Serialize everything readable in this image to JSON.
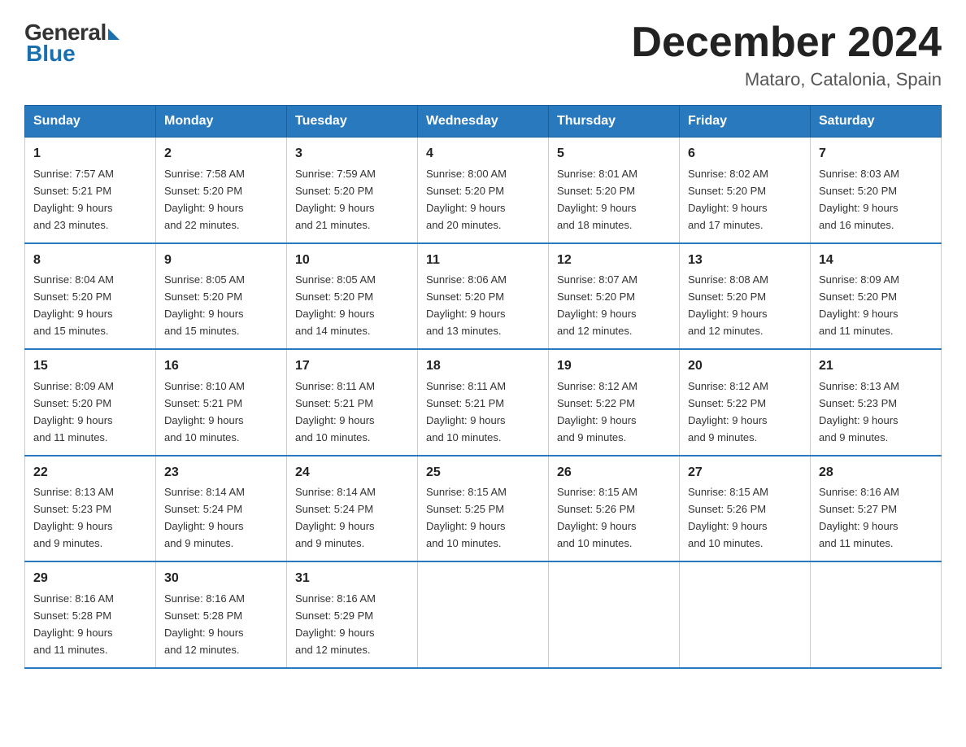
{
  "logo": {
    "general": "General",
    "blue": "Blue"
  },
  "title": "December 2024",
  "location": "Mataro, Catalonia, Spain",
  "days_of_week": [
    "Sunday",
    "Monday",
    "Tuesday",
    "Wednesday",
    "Thursday",
    "Friday",
    "Saturday"
  ],
  "weeks": [
    [
      {
        "day": "1",
        "sunrise": "7:57 AM",
        "sunset": "5:21 PM",
        "daylight": "9 hours and 23 minutes."
      },
      {
        "day": "2",
        "sunrise": "7:58 AM",
        "sunset": "5:20 PM",
        "daylight": "9 hours and 22 minutes."
      },
      {
        "day": "3",
        "sunrise": "7:59 AM",
        "sunset": "5:20 PM",
        "daylight": "9 hours and 21 minutes."
      },
      {
        "day": "4",
        "sunrise": "8:00 AM",
        "sunset": "5:20 PM",
        "daylight": "9 hours and 20 minutes."
      },
      {
        "day": "5",
        "sunrise": "8:01 AM",
        "sunset": "5:20 PM",
        "daylight": "9 hours and 18 minutes."
      },
      {
        "day": "6",
        "sunrise": "8:02 AM",
        "sunset": "5:20 PM",
        "daylight": "9 hours and 17 minutes."
      },
      {
        "day": "7",
        "sunrise": "8:03 AM",
        "sunset": "5:20 PM",
        "daylight": "9 hours and 16 minutes."
      }
    ],
    [
      {
        "day": "8",
        "sunrise": "8:04 AM",
        "sunset": "5:20 PM",
        "daylight": "9 hours and 15 minutes."
      },
      {
        "day": "9",
        "sunrise": "8:05 AM",
        "sunset": "5:20 PM",
        "daylight": "9 hours and 15 minutes."
      },
      {
        "day": "10",
        "sunrise": "8:05 AM",
        "sunset": "5:20 PM",
        "daylight": "9 hours and 14 minutes."
      },
      {
        "day": "11",
        "sunrise": "8:06 AM",
        "sunset": "5:20 PM",
        "daylight": "9 hours and 13 minutes."
      },
      {
        "day": "12",
        "sunrise": "8:07 AM",
        "sunset": "5:20 PM",
        "daylight": "9 hours and 12 minutes."
      },
      {
        "day": "13",
        "sunrise": "8:08 AM",
        "sunset": "5:20 PM",
        "daylight": "9 hours and 12 minutes."
      },
      {
        "day": "14",
        "sunrise": "8:09 AM",
        "sunset": "5:20 PM",
        "daylight": "9 hours and 11 minutes."
      }
    ],
    [
      {
        "day": "15",
        "sunrise": "8:09 AM",
        "sunset": "5:20 PM",
        "daylight": "9 hours and 11 minutes."
      },
      {
        "day": "16",
        "sunrise": "8:10 AM",
        "sunset": "5:21 PM",
        "daylight": "9 hours and 10 minutes."
      },
      {
        "day": "17",
        "sunrise": "8:11 AM",
        "sunset": "5:21 PM",
        "daylight": "9 hours and 10 minutes."
      },
      {
        "day": "18",
        "sunrise": "8:11 AM",
        "sunset": "5:21 PM",
        "daylight": "9 hours and 10 minutes."
      },
      {
        "day": "19",
        "sunrise": "8:12 AM",
        "sunset": "5:22 PM",
        "daylight": "9 hours and 9 minutes."
      },
      {
        "day": "20",
        "sunrise": "8:12 AM",
        "sunset": "5:22 PM",
        "daylight": "9 hours and 9 minutes."
      },
      {
        "day": "21",
        "sunrise": "8:13 AM",
        "sunset": "5:23 PM",
        "daylight": "9 hours and 9 minutes."
      }
    ],
    [
      {
        "day": "22",
        "sunrise": "8:13 AM",
        "sunset": "5:23 PM",
        "daylight": "9 hours and 9 minutes."
      },
      {
        "day": "23",
        "sunrise": "8:14 AM",
        "sunset": "5:24 PM",
        "daylight": "9 hours and 9 minutes."
      },
      {
        "day": "24",
        "sunrise": "8:14 AM",
        "sunset": "5:24 PM",
        "daylight": "9 hours and 9 minutes."
      },
      {
        "day": "25",
        "sunrise": "8:15 AM",
        "sunset": "5:25 PM",
        "daylight": "9 hours and 10 minutes."
      },
      {
        "day": "26",
        "sunrise": "8:15 AM",
        "sunset": "5:26 PM",
        "daylight": "9 hours and 10 minutes."
      },
      {
        "day": "27",
        "sunrise": "8:15 AM",
        "sunset": "5:26 PM",
        "daylight": "9 hours and 10 minutes."
      },
      {
        "day": "28",
        "sunrise": "8:16 AM",
        "sunset": "5:27 PM",
        "daylight": "9 hours and 11 minutes."
      }
    ],
    [
      {
        "day": "29",
        "sunrise": "8:16 AM",
        "sunset": "5:28 PM",
        "daylight": "9 hours and 11 minutes."
      },
      {
        "day": "30",
        "sunrise": "8:16 AM",
        "sunset": "5:28 PM",
        "daylight": "9 hours and 12 minutes."
      },
      {
        "day": "31",
        "sunrise": "8:16 AM",
        "sunset": "5:29 PM",
        "daylight": "9 hours and 12 minutes."
      },
      null,
      null,
      null,
      null
    ]
  ]
}
